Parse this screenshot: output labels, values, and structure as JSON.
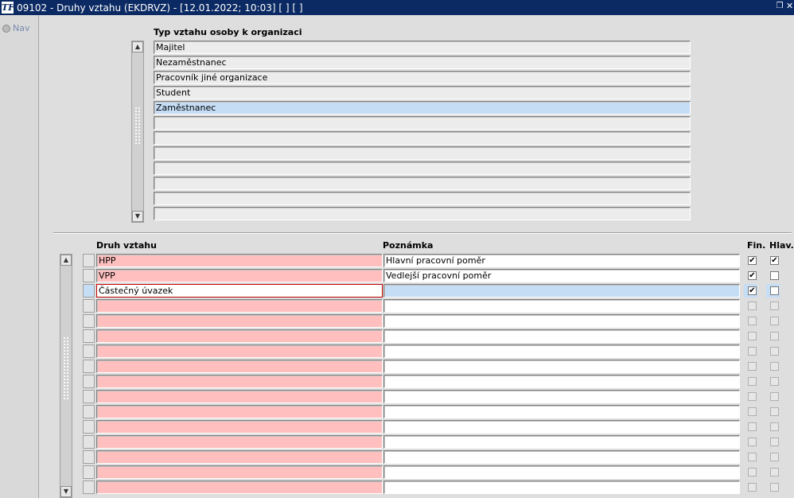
{
  "window": {
    "title": "09102 - Druhy vztahu (EKDRVZ) - [12.01.2022; 10:03]  [ ]  [ ]",
    "app_icon_text": "TF"
  },
  "nav": {
    "label": "Nav"
  },
  "top_block": {
    "header": "Typ vztahu osoby k organizaci",
    "rows": [
      "Majitel",
      "Nezaměstnanec",
      "Pracovník jiné organizace",
      "Student",
      "Zaměstnanec",
      "",
      "",
      "",
      "",
      "",
      "",
      ""
    ],
    "selected_index": 4
  },
  "bottom_block": {
    "headers": {
      "druh": "Druh vztahu",
      "poznamka": "Poznámka",
      "fin": "Fin.",
      "hlav": "Hlav."
    },
    "rows": [
      {
        "druh": "HPP",
        "poznamka": "Hlavní pracovní poměr",
        "fin": true,
        "hlav": true
      },
      {
        "druh": "VPP",
        "poznamka": "Vedlejší pracovní poměr",
        "fin": true,
        "hlav": false
      },
      {
        "druh": "Částečný úvazek",
        "poznamka": "",
        "fin": true,
        "hlav": false
      },
      {
        "druh": "",
        "poznamka": "",
        "fin": false,
        "hlav": false
      },
      {
        "druh": "",
        "poznamka": "",
        "fin": false,
        "hlav": false
      },
      {
        "druh": "",
        "poznamka": "",
        "fin": false,
        "hlav": false
      },
      {
        "druh": "",
        "poznamka": "",
        "fin": false,
        "hlav": false
      },
      {
        "druh": "",
        "poznamka": "",
        "fin": false,
        "hlav": false
      },
      {
        "druh": "",
        "poznamka": "",
        "fin": false,
        "hlav": false
      },
      {
        "druh": "",
        "poznamka": "",
        "fin": false,
        "hlav": false
      },
      {
        "druh": "",
        "poznamka": "",
        "fin": false,
        "hlav": false
      },
      {
        "druh": "",
        "poznamka": "",
        "fin": false,
        "hlav": false
      },
      {
        "druh": "",
        "poznamka": "",
        "fin": false,
        "hlav": false
      },
      {
        "druh": "",
        "poznamka": "",
        "fin": false,
        "hlav": false
      },
      {
        "druh": "",
        "poznamka": "",
        "fin": false,
        "hlav": false
      },
      {
        "druh": "",
        "poznamka": "",
        "fin": false,
        "hlav": false
      }
    ],
    "current_index": 2
  }
}
